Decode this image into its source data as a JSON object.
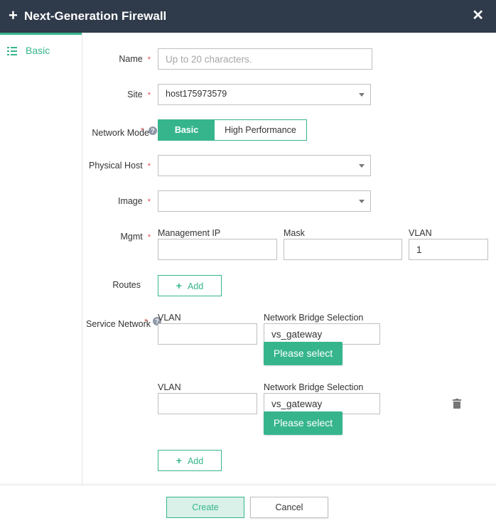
{
  "window": {
    "title": "Next-Generation Firewall"
  },
  "sidebar": {
    "items": [
      {
        "label": "Basic"
      }
    ]
  },
  "form": {
    "name": {
      "label": "Name",
      "placeholder": "Up to 20 characters."
    },
    "site": {
      "label": "Site",
      "value": "host175973579"
    },
    "network_mode": {
      "label": "Network Mode",
      "options": [
        "Basic",
        "High Performance"
      ],
      "selected": "Basic"
    },
    "physical_host": {
      "label": "Physical Host",
      "value": ""
    },
    "image": {
      "label": "Image",
      "value": ""
    },
    "mgmt": {
      "label": "Mgmt",
      "ip_label": "Management IP",
      "ip_value": "",
      "mask_label": "Mask",
      "mask_value": "",
      "vlan_label": "VLAN",
      "vlan_value": "1"
    },
    "routes": {
      "label": "Routes",
      "add_label": "Add"
    },
    "service_network": {
      "label": "Service Network",
      "rows": [
        {
          "vlan_label": "VLAN",
          "vlan_value": "",
          "bridge_label": "Network Bridge Selection",
          "bridge_value": "vs_gateway",
          "select_label": "Please select"
        },
        {
          "vlan_label": "VLAN",
          "vlan_value": "",
          "bridge_label": "Network Bridge Selection",
          "bridge_value": "vs_gateway",
          "select_label": "Please select"
        }
      ],
      "add_label": "Add"
    }
  },
  "footer": {
    "create_label": "Create",
    "cancel_label": "Cancel"
  },
  "colors": {
    "accent": "#36b58d",
    "titlebar": "#2f3a4a",
    "required": "#e04a4a"
  }
}
